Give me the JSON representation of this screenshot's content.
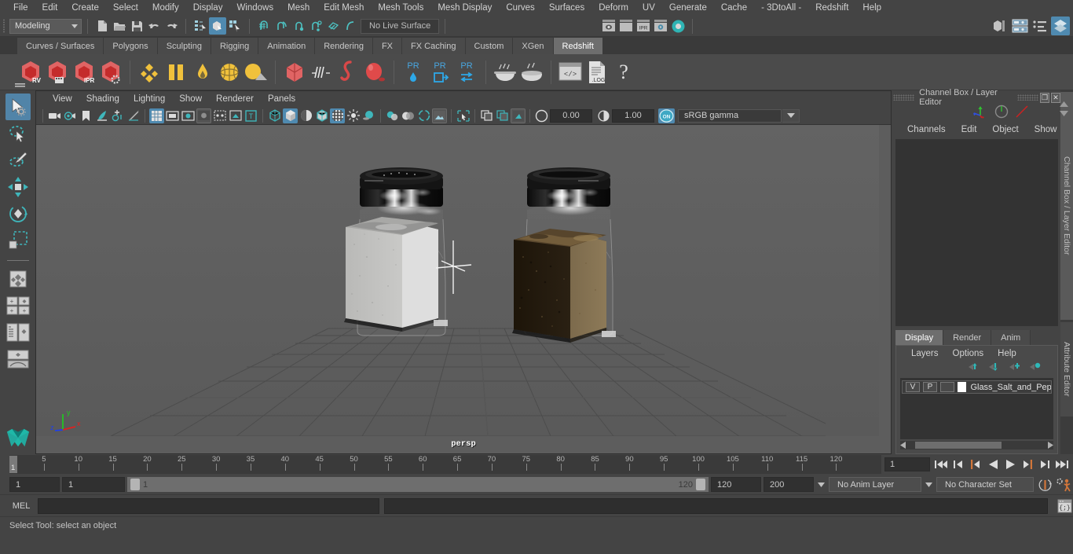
{
  "menubar": {
    "items": [
      "File",
      "Edit",
      "Create",
      "Select",
      "Modify",
      "Display",
      "Windows",
      "Mesh",
      "Edit Mesh",
      "Mesh Tools",
      "Mesh Display",
      "Curves",
      "Surfaces",
      "Deform",
      "UV",
      "Generate",
      "Cache",
      "- 3DtoAll -",
      "Redshift",
      "Help"
    ]
  },
  "statusline": {
    "mode": "Modeling",
    "live_surface": "No Live Surface",
    "icons": [
      "new-scene-icon",
      "open-scene-icon",
      "save-scene-icon",
      "undo-icon",
      "redo-icon",
      "select-by-hierarchy-icon",
      "select-by-object-icon",
      "select-by-component-icon",
      "snap-to-grid-icon",
      "snap-to-curve-icon",
      "snap-to-point-icon",
      "snap-to-projected-center-icon",
      "snap-to-view-plane-icon",
      "make-live-icon"
    ],
    "render_icons": [
      "render-current-frame-icon",
      "render-sequence-icon",
      "ipr-render-icon",
      "render-settings-icon",
      "hypershade-icon"
    ],
    "right_icons": [
      "show-hide-modeling-toolkit-icon",
      "show-hide-attribute-editor-icon",
      "show-hide-tool-settings-icon",
      "show-hide-channel-box-icon"
    ]
  },
  "shelf": {
    "tabs": [
      "Curves / Surfaces",
      "Polygons",
      "Sculpting",
      "Rigging",
      "Animation",
      "Rendering",
      "FX",
      "FX Caching",
      "Custom",
      "XGen",
      "Redshift"
    ],
    "selected_tab": "Redshift",
    "buttons": [
      {
        "name": "redshift-render-view-icon",
        "label": "RV"
      },
      {
        "name": "redshift-render-sequence-icon",
        "label": ""
      },
      {
        "name": "redshift-ipr-icon",
        "label": "IPR"
      },
      {
        "name": "redshift-render-settings-icon",
        "label": ""
      },
      {
        "name": "redshift-material-icon",
        "label": ""
      },
      {
        "name": "redshift-bump-icon",
        "label": ""
      },
      {
        "name": "redshift-light-dome-icon",
        "label": ""
      },
      {
        "name": "redshift-sphere-light-icon",
        "label": ""
      },
      {
        "name": "redshift-area-light-icon",
        "label": ""
      },
      {
        "name": "redshift-proxy-icon",
        "label": ""
      },
      {
        "name": "redshift-hair-icon",
        "label": ""
      },
      {
        "name": "redshift-volume-icon",
        "label": ""
      },
      {
        "name": "redshift-sprite-icon",
        "label": ""
      },
      {
        "name": "redshift-pr-lens-icon",
        "label": "PR"
      },
      {
        "name": "redshift-pr-export-icon",
        "label": "PR"
      },
      {
        "name": "redshift-pr-baking-icon",
        "label": "PR"
      },
      {
        "name": "redshift-bake-icon",
        "label": ""
      },
      {
        "name": "redshift-bake-all-icon",
        "label": ""
      },
      {
        "name": "redshift-script-icon",
        "label": ""
      },
      {
        "name": "redshift-log-icon",
        "label": ".LOG"
      },
      {
        "name": "redshift-help-icon",
        "label": "?"
      }
    ]
  },
  "toolbox": {
    "items": [
      "select-tool-icon",
      "lasso-select-tool-icon",
      "paint-select-tool-icon",
      "move-tool-icon",
      "rotate-tool-icon",
      "scale-tool-icon",
      "last-tool-used-icon",
      "four-view-layout-icon",
      "two-pane-layout-icon",
      "outliner-persp-layout-icon",
      "persp-graph-layout-icon",
      "maya-logo-icon"
    ],
    "selected": "select-tool-icon"
  },
  "viewport": {
    "menus": [
      "View",
      "Shading",
      "Lighting",
      "Show",
      "Renderer",
      "Panels"
    ],
    "camera_label": "persp",
    "exposure": "0.00",
    "gamma": "1.00",
    "color_space": "sRGB gamma",
    "toggle_on": "ON",
    "toolbar_icons": [
      "select-camera-icon",
      "camera-attributes-icon",
      "bookmark-icon",
      "image-plane-icon",
      "two-d-pan-zoom-icon",
      "grease-pencil-icon",
      "grid-toggle-icon",
      "film-gate-icon",
      "resolution-gate-icon",
      "gate-mask-icon",
      "xray-joints-icon",
      "xray-icon",
      "texture-borders-icon",
      "wireframe-shading-icon",
      "smooth-shade-all-icon",
      "smooth-shade-flat-icon",
      "wireframe-on-shaded-icon",
      "textured-icon",
      "use-default-lighting-icon",
      "shadows-icon",
      "screen-space-ao-icon",
      "motion-blur-icon",
      "multisample-aa-icon",
      "viewport-render-icon",
      "isolate-select-icon"
    ]
  },
  "right_panel": {
    "title": "Channel Box / Layer Editor",
    "menus": [
      "Channels",
      "Edit",
      "Object",
      "Show"
    ],
    "minimize_glyph": "❐",
    "close_glyph": "✕",
    "vertical_tabs": [
      "Channel Box / Layer Editor",
      "Attribute Editor"
    ],
    "layer_tabs": [
      "Display",
      "Render",
      "Anim"
    ],
    "selected_layer_tab": "Display",
    "layer_menus": [
      "Layers",
      "Options",
      "Help"
    ],
    "layer_buttons": [
      "move-layer-up-icon",
      "move-layer-down-icon",
      "create-new-layer-icon",
      "create-layer-from-selected-icon"
    ],
    "layers": [
      {
        "visibility": "V",
        "playback": "P",
        "shading": "",
        "color": "#ffffff",
        "name": "Glass_Salt_and_Peppe"
      }
    ]
  },
  "timeline": {
    "ticks": [
      5,
      10,
      15,
      20,
      25,
      30,
      35,
      40,
      45,
      50,
      55,
      60,
      65,
      70,
      75,
      80,
      85,
      90,
      95,
      100,
      105,
      110,
      115,
      120
    ],
    "current_frame": "1",
    "current_frame_field": "1",
    "playback_buttons": [
      "go-to-start-icon",
      "step-back-keyframe-icon",
      "step-back-frame-icon",
      "play-backwards-icon",
      "play-forwards-icon",
      "step-forward-frame-icon",
      "step-forward-keyframe-icon",
      "go-to-end-icon"
    ]
  },
  "range": {
    "anim_start": "1",
    "range_start": "1",
    "bar_start_label": "1",
    "bar_end_label": "120",
    "range_end": "120",
    "anim_end": "200",
    "anim_layer": "No Anim Layer",
    "character_set": "No Character Set",
    "right_icons": [
      "auto-keyframe-toggle-icon",
      "animation-preferences-icon"
    ]
  },
  "command_line": {
    "language_label": "MEL",
    "input_value": "",
    "output_value": "",
    "script_editor_icon": "script-editor-icon"
  },
  "help_line": {
    "text": "Select Tool: select an object"
  },
  "colors": {
    "accent_blue": "#4f8ab0",
    "panel_bg": "#444444",
    "viewport_bg": "#5d5d5d",
    "field_bg": "#303030",
    "orange": "#d2763a",
    "teal": "#4dc2c2"
  }
}
